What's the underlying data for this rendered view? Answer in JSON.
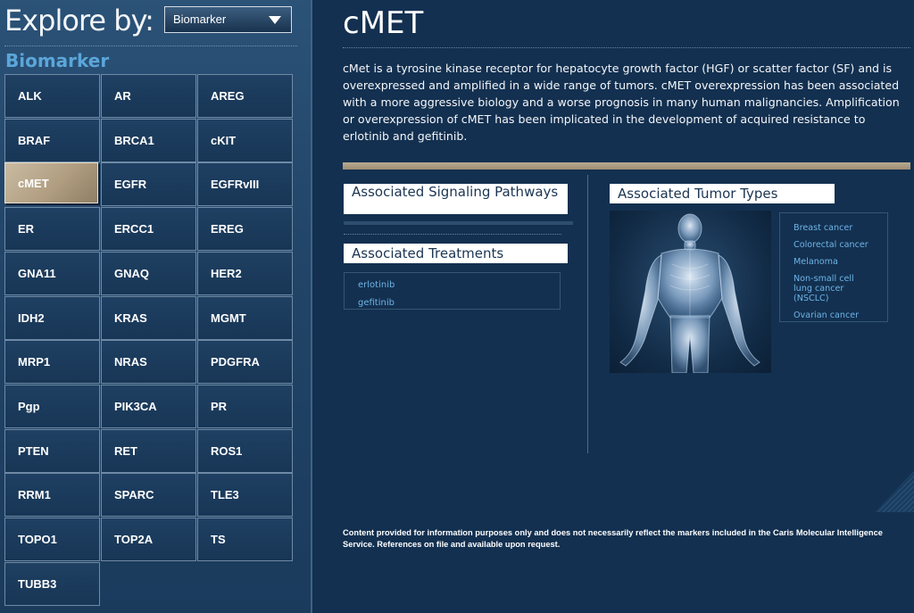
{
  "explore": {
    "label": "Explore by:",
    "select_value": "Biomarker"
  },
  "section_title": "Biomarker",
  "biomarkers": [
    "ALK",
    "AR",
    "AREG",
    "BRAF",
    "BRCA1",
    "cKIT",
    "cMET",
    "EGFR",
    "EGFRvIII",
    "ER",
    "ERCC1",
    "EREG",
    "GNA11",
    "GNAQ",
    "HER2",
    "IDH2",
    "KRAS",
    "MGMT",
    "MRP1",
    "NRAS",
    "PDGFRA",
    "Pgp",
    "PIK3CA",
    "PR",
    "PTEN",
    "RET",
    "ROS1",
    "RRM1",
    "SPARC",
    "TLE3",
    "TOPO1",
    "TOP2A",
    "TS",
    "TUBB3"
  ],
  "selected_biomarker": "cMET",
  "detail": {
    "title": "cMET",
    "description": "cMet is a tyrosine kinase receptor for hepatocyte growth factor (HGF) or scatter factor (SF) and is overexpressed and amplified in a wide range of tumors. cMET overexpression has been associated with a more aggressive biology and a worse prognosis in many human malignancies. Amplification or overexpression of cMET has been implicated in the development of acquired resistance to erlotinib and gefitinib.",
    "signaling_header": "Associated Signaling Pathways",
    "treatments_header": "Associated Treatments",
    "treatments": [
      "erlotinib",
      "gefitinib"
    ],
    "tumor_header": "Associated Tumor Types",
    "tumor_types": [
      "Breast cancer",
      "Colorectal cancer",
      "Melanoma",
      "Non-small cell lung cancer (NSCLC)",
      "Ovarian cancer"
    ]
  },
  "footnote": "Content provided for information purposes only and does not necessarily reflect the markers included in the Caris Molecular Intelligence Service. References on file and available upon request.",
  "colors": {
    "accent_blue": "#5ba6da",
    "link_blue": "#6db4e6",
    "selected_tan": "#b19e81",
    "background": "#133050"
  }
}
